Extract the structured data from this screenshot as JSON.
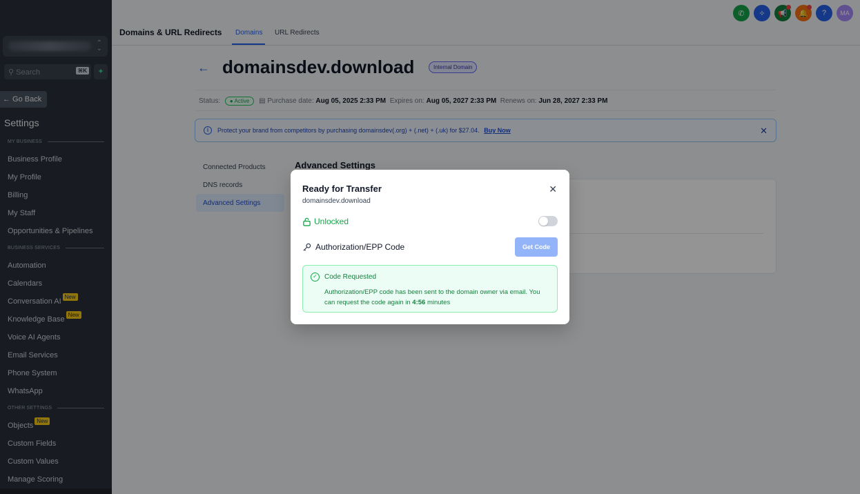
{
  "sidebar": {
    "search_placeholder": "Search",
    "search_shortcut": "⌘K",
    "go_back": "← Go Back",
    "settings_title": "Settings",
    "sections": {
      "my_business": "MY BUSINESS",
      "business_services": "BUSINESS SERVICES",
      "other_settings": "OTHER SETTINGS"
    },
    "items": {
      "business_profile": "Business Profile",
      "my_profile": "My Profile",
      "billing": "Billing",
      "my_staff": "My Staff",
      "opportunities": "Opportunities & Pipelines",
      "automation": "Automation",
      "calendars": "Calendars",
      "conversation_ai": "Conversation AI",
      "knowledge_base": "Knowledge Base",
      "voice_ai": "Voice AI Agents",
      "email_services": "Email Services",
      "phone_system": "Phone System",
      "whatsapp": "WhatsApp",
      "objects": "Objects",
      "custom_fields": "Custom Fields",
      "custom_values": "Custom Values",
      "manage_scoring": "Manage Scoring"
    },
    "new_badge": "New"
  },
  "header": {
    "title": "Domains & URL Redirects",
    "tabs": [
      "Domains",
      "URL Redirects"
    ],
    "avatar_initials": "MA",
    "help_label": "?",
    "icon_colors": [
      "#16a34a",
      "#2563eb",
      "#15803d",
      "#f97316",
      "#2563eb",
      "#a78bfa"
    ]
  },
  "domain": {
    "name": "domainsdev.download",
    "badge": "Internal Domain",
    "status_label": "Status:",
    "status_value": "Active",
    "purchase_label": "Purchase date:",
    "purchase_value": "Aug 05, 2025 2:33 PM",
    "expires_label": "Expires on:",
    "expires_value": "Aug 05, 2027 2:33 PM",
    "renews_label": "Renews on:",
    "renews_value": "Jun 28, 2027 2:33 PM"
  },
  "banner": {
    "text": "Protect your brand from competitors by purchasing domainsdev(.org) + (.net) + (.uk) for $27.04.",
    "link": "Buy Now"
  },
  "left_menu": [
    "Connected Products",
    "DNS records",
    "Advanced Settings"
  ],
  "advanced_heading": "Advanced Settings",
  "modal": {
    "title": "Ready for Transfer",
    "subtitle": "domainsdev.download",
    "unlocked_label": "Unlocked",
    "auth_label": "Authorization/EPP Code",
    "get_code": "Get Code",
    "code_title": "Code Requested",
    "code_text": "Authorization/EPP code has been sent to the domain owner via email. You can request the code again in",
    "code_timer": "4:56",
    "code_suffix": "minutes"
  }
}
